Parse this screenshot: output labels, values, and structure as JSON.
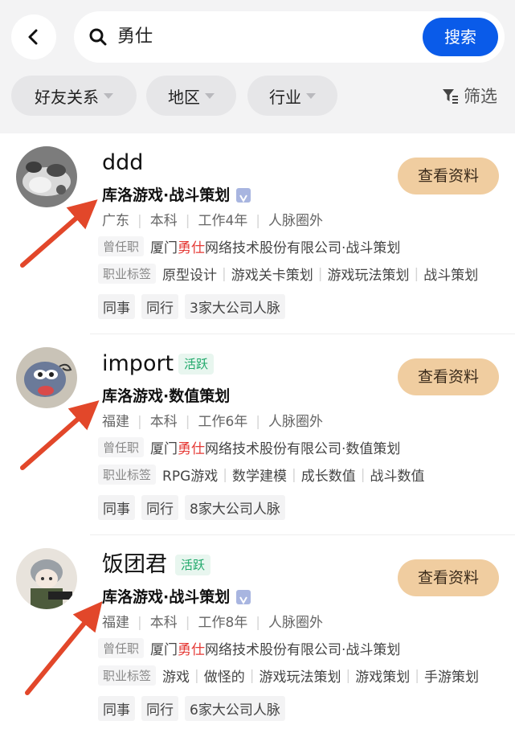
{
  "search": {
    "query": "勇仕",
    "button": "搜索"
  },
  "filters": {
    "chips": [
      "好友关系",
      "地区",
      "行业"
    ],
    "filter_label": "筛选"
  },
  "common": {
    "view_profile": "查看资料",
    "former_label": "曾任职",
    "tags_label": "职业标签"
  },
  "results": [
    {
      "name": "ddd",
      "active": "",
      "title": "库洛游戏·战斗策划",
      "verified": true,
      "meta": [
        "广东",
        "本科",
        "工作4年",
        "人脉圈外"
      ],
      "former": {
        "pre": "厦门",
        "hl": "勇仕",
        "post": "网络技术股份有限公司·战斗策划"
      },
      "tags": [
        "原型设计",
        "游戏关卡策划",
        "游戏玩法策划",
        "战斗策划"
      ],
      "relations": [
        "同事",
        "同行",
        "3家大公司人脉"
      ]
    },
    {
      "name": "import",
      "active": "活跃",
      "title": "库洛游戏·数值策划",
      "verified": false,
      "meta": [
        "福建",
        "本科",
        "工作6年",
        "人脉圈外"
      ],
      "former": {
        "pre": "厦门",
        "hl": "勇仕",
        "post": "网络技术股份有限公司·数值策划"
      },
      "tags": [
        "RPG游戏",
        "数学建模",
        "成长数值",
        "战斗数值"
      ],
      "relations": [
        "同事",
        "同行",
        "8家大公司人脉"
      ]
    },
    {
      "name": "饭团君",
      "active": "活跃",
      "title": "库洛游戏·战斗策划",
      "verified": true,
      "meta": [
        "福建",
        "本科",
        "工作8年",
        "人脉圈外"
      ],
      "former": {
        "pre": "厦门",
        "hl": "勇仕",
        "post": "网络技术股份有限公司·战斗策划"
      },
      "tags": [
        "游戏",
        "做怪的",
        "游戏玩法策划",
        "游戏策划",
        "手游策划"
      ],
      "relations": [
        "同事",
        "同行",
        "6家大公司人脉"
      ]
    }
  ],
  "colors": {
    "accent_blue": "#0a5be9",
    "view_btn": "#f0cda0",
    "highlight": "#e53935",
    "active_green": "#1fa86a",
    "arrow": "#e2472a"
  },
  "icons": [
    "back-icon",
    "search-icon",
    "filter-icon",
    "verified-icon",
    "arrow-annotation"
  ]
}
